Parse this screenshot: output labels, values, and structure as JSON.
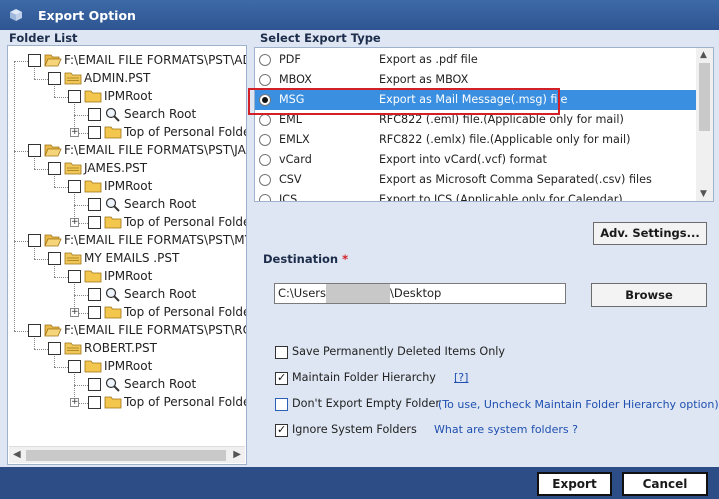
{
  "window": {
    "title": "Export Option"
  },
  "folder_list": {
    "label": "Folder List",
    "nodes": [
      {
        "label": "F:\\EMAIL FILE FORMATS\\PST\\ADM",
        "level": 0,
        "icon": "folder-open-icon"
      },
      {
        "label": "ADMIN.PST",
        "level": 1,
        "icon": "pst-folder-icon"
      },
      {
        "label": "IPMRoot",
        "level": 2,
        "icon": "folder-icon"
      },
      {
        "label": "Search Root",
        "level": 3,
        "icon": "search-folder-icon"
      },
      {
        "label": "Top of Personal Folders",
        "level": 3,
        "icon": "folder-icon",
        "expandable": true
      },
      {
        "label": "F:\\EMAIL FILE FORMATS\\PST\\JAME",
        "level": 0,
        "icon": "folder-open-icon"
      },
      {
        "label": "JAMES.PST",
        "level": 1,
        "icon": "pst-folder-icon"
      },
      {
        "label": "IPMRoot",
        "level": 2,
        "icon": "folder-icon"
      },
      {
        "label": "Search Root",
        "level": 3,
        "icon": "search-folder-icon"
      },
      {
        "label": "Top of Personal Folders",
        "level": 3,
        "icon": "folder-icon",
        "expandable": true
      },
      {
        "label": "F:\\EMAIL FILE FORMATS\\PST\\MY E",
        "level": 0,
        "icon": "folder-open-icon"
      },
      {
        "label": "MY EMAILS .PST",
        "level": 1,
        "icon": "pst-folder-icon"
      },
      {
        "label": "IPMRoot",
        "level": 2,
        "icon": "folder-icon"
      },
      {
        "label": "Search Root",
        "level": 3,
        "icon": "search-folder-icon"
      },
      {
        "label": "Top of Personal Folders",
        "level": 3,
        "icon": "folder-icon",
        "expandable": true
      },
      {
        "label": "F:\\EMAIL FILE FORMATS\\PST\\ROBE",
        "level": 0,
        "icon": "folder-open-icon"
      },
      {
        "label": "ROBERT.PST",
        "level": 1,
        "icon": "pst-folder-icon"
      },
      {
        "label": "IPMRoot",
        "level": 2,
        "icon": "folder-icon"
      },
      {
        "label": "Search Root",
        "level": 3,
        "icon": "search-folder-icon"
      },
      {
        "label": "Top of Personal Folders",
        "level": 3,
        "icon": "folder-icon",
        "expandable": true
      }
    ]
  },
  "export_type": {
    "label": "Select Export Type",
    "selected": "MSG",
    "options": [
      {
        "name": "PDF",
        "desc": "Export as .pdf file"
      },
      {
        "name": "MBOX",
        "desc": "Export as MBOX"
      },
      {
        "name": "MSG",
        "desc": "Export as Mail Message(.msg) file"
      },
      {
        "name": "EML",
        "desc": "RFC822 (.eml) file.(Applicable only for mail)"
      },
      {
        "name": "EMLX",
        "desc": "RFC822 (.emlx) file.(Applicable only for mail)"
      },
      {
        "name": "vCard",
        "desc": "Export into vCard(.vcf) format"
      },
      {
        "name": "CSV",
        "desc": "Export as Microsoft Comma Separated(.csv) files"
      },
      {
        "name": "ICS",
        "desc": "Export to ICS (Applicable only for Calendar)"
      }
    ]
  },
  "adv_settings_label": "Adv. Settings...",
  "destination": {
    "label": "Destination",
    "required_mark": "*",
    "path_prefix": "C:\\Users",
    "path_suffix": "\\Desktop",
    "browse_label": "Browse"
  },
  "options": {
    "save_deleted": {
      "label": "Save Permanently Deleted Items Only",
      "checked": false
    },
    "maintain_hierarchy": {
      "label": "Maintain Folder Hierarchy",
      "checked": true,
      "help": "[?]"
    },
    "dont_export_empty": {
      "label": "Don't Export Empty Folder",
      "checked": false,
      "note": "(To use, Uncheck Maintain Folder Hierarchy option)"
    },
    "ignore_system": {
      "label": "Ignore System Folders",
      "checked": true,
      "link": "What are system folders ?"
    }
  },
  "footer": {
    "export_label": "Export",
    "cancel_label": "Cancel"
  },
  "colors": {
    "title_bar": "#2e5591",
    "footer": "#2c4d85",
    "client_bg": "#dde6f2",
    "selected_row": "#3a8fe0",
    "highlight_border": "#d32027",
    "link": "#1f4fb0"
  }
}
